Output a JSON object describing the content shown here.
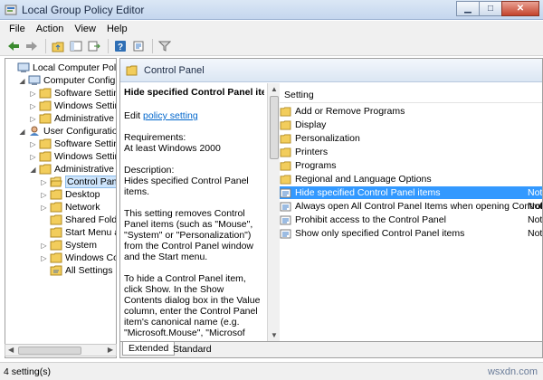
{
  "window": {
    "title": "Local Group Policy Editor"
  },
  "menu": [
    "File",
    "Action",
    "View",
    "Help"
  ],
  "tree": [
    {
      "label": "Local Computer Policy",
      "icon": "computer-icon",
      "level": 0,
      "exp": ""
    },
    {
      "label": "Computer Configura",
      "icon": "computer-icon",
      "level": 1,
      "exp": "◢"
    },
    {
      "label": "Software Settings",
      "icon": "folder-icon",
      "level": 2,
      "exp": "▷"
    },
    {
      "label": "Windows Setting",
      "icon": "folder-icon",
      "level": 2,
      "exp": "▷"
    },
    {
      "label": "Administrative Te",
      "icon": "folder-icon",
      "level": 2,
      "exp": "▷"
    },
    {
      "label": "User Configuration",
      "icon": "user-icon",
      "level": 1,
      "exp": "◢"
    },
    {
      "label": "Software Settings",
      "icon": "folder-icon",
      "level": 2,
      "exp": "▷"
    },
    {
      "label": "Windows Setting",
      "icon": "folder-icon",
      "level": 2,
      "exp": "▷"
    },
    {
      "label": "Administrative Te",
      "icon": "folder-icon",
      "level": 2,
      "exp": "◢"
    },
    {
      "label": "Control Panel",
      "icon": "folder-open-icon",
      "level": 3,
      "exp": "▷",
      "selected": true
    },
    {
      "label": "Desktop",
      "icon": "folder-icon",
      "level": 3,
      "exp": "▷"
    },
    {
      "label": "Network",
      "icon": "folder-icon",
      "level": 3,
      "exp": "▷"
    },
    {
      "label": "Shared Folder",
      "icon": "folder-icon",
      "level": 3,
      "exp": ""
    },
    {
      "label": "Start Menu an",
      "icon": "folder-icon",
      "level": 3,
      "exp": ""
    },
    {
      "label": "System",
      "icon": "folder-icon",
      "level": 3,
      "exp": "▷"
    },
    {
      "label": "Windows Com",
      "icon": "folder-icon",
      "level": 3,
      "exp": "▷"
    },
    {
      "label": "All Settings",
      "icon": "settings-icon",
      "level": 3,
      "exp": ""
    }
  ],
  "header": {
    "title": "Control Panel"
  },
  "description": {
    "title": "Hide specified Control Panel items",
    "edit_prefix": "Edit ",
    "edit_link": "policy setting",
    "requirements_label": "Requirements:",
    "requirements_value": "At least Windows 2000",
    "description_label": "Description:",
    "description_value": "Hides specified Control Panel items.",
    "para1": "This setting removes Control Panel items (such as \"Mouse\", \"System\" or \"Personalization\") from the Control Panel window and the Start menu.",
    "para2": "To hide a Control Panel item, click Show. In the Show Contents dialog box in the Value column, enter the Control Panel item's canonical name (e.g. \"Microsoft.Mouse\", \"Microsof"
  },
  "settings": {
    "column": "Setting",
    "rows": [
      {
        "name": "Add or Remove Programs",
        "icon": "folder-icon",
        "state": ""
      },
      {
        "name": "Display",
        "icon": "folder-icon",
        "state": ""
      },
      {
        "name": "Personalization",
        "icon": "folder-icon",
        "state": ""
      },
      {
        "name": "Printers",
        "icon": "folder-icon",
        "state": ""
      },
      {
        "name": "Programs",
        "icon": "folder-icon",
        "state": ""
      },
      {
        "name": "Regional and Language Options",
        "icon": "folder-icon",
        "state": ""
      },
      {
        "name": "Hide specified Control Panel items",
        "icon": "policy-icon",
        "state": "Not",
        "selected": true
      },
      {
        "name": "Always open All Control Panel Items when opening Control ...",
        "icon": "policy-icon",
        "state": "Not"
      },
      {
        "name": "Prohibit access to the Control Panel",
        "icon": "policy-icon",
        "state": "Not"
      },
      {
        "name": "Show only specified Control Panel items",
        "icon": "policy-icon",
        "state": "Not"
      }
    ]
  },
  "tabs": [
    "Extended",
    "Standard"
  ],
  "status": {
    "text": "4 setting(s)"
  },
  "watermark": "wsxdn.com"
}
